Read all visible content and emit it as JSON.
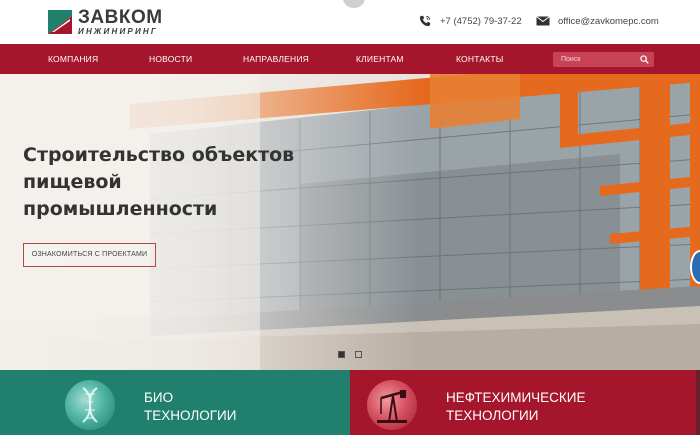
{
  "header": {
    "logo_title": "ЗАВКОМ",
    "logo_subtitle": "ИНЖИНИРИНГ",
    "phone": "+7 (4752) 79-37-22",
    "email": "office@zavkomepc.com"
  },
  "nav": {
    "items": [
      "КОМПАНИЯ",
      "НОВОСТИ",
      "НАПРАВЛЕНИЯ",
      "КЛИЕНТАМ",
      "КОНТАКТЫ"
    ],
    "search_placeholder": "Поиск"
  },
  "hero": {
    "title_lines": [
      "Строительство объектов",
      "пищевой",
      "промышленности"
    ],
    "button_label": "ОЗНАКОМИТЬСЯ С ПРОЕКТАМИ",
    "slides_total": 2,
    "active_slide": 1
  },
  "cards": [
    {
      "line1": "БИО",
      "line2": "ТЕХНОЛОГИИ",
      "color": "#21806d"
    },
    {
      "line1": "НЕФТЕХИМИЧЕСКИЕ",
      "line2": "ТЕХНОЛОГИИ",
      "color": "#a5162c"
    }
  ],
  "colors": {
    "brand_red": "#a5162c",
    "brand_green": "#21806d",
    "accent_orange": "#e56a1e"
  },
  "icons": [
    "phone-icon",
    "email-icon",
    "search-icon"
  ]
}
